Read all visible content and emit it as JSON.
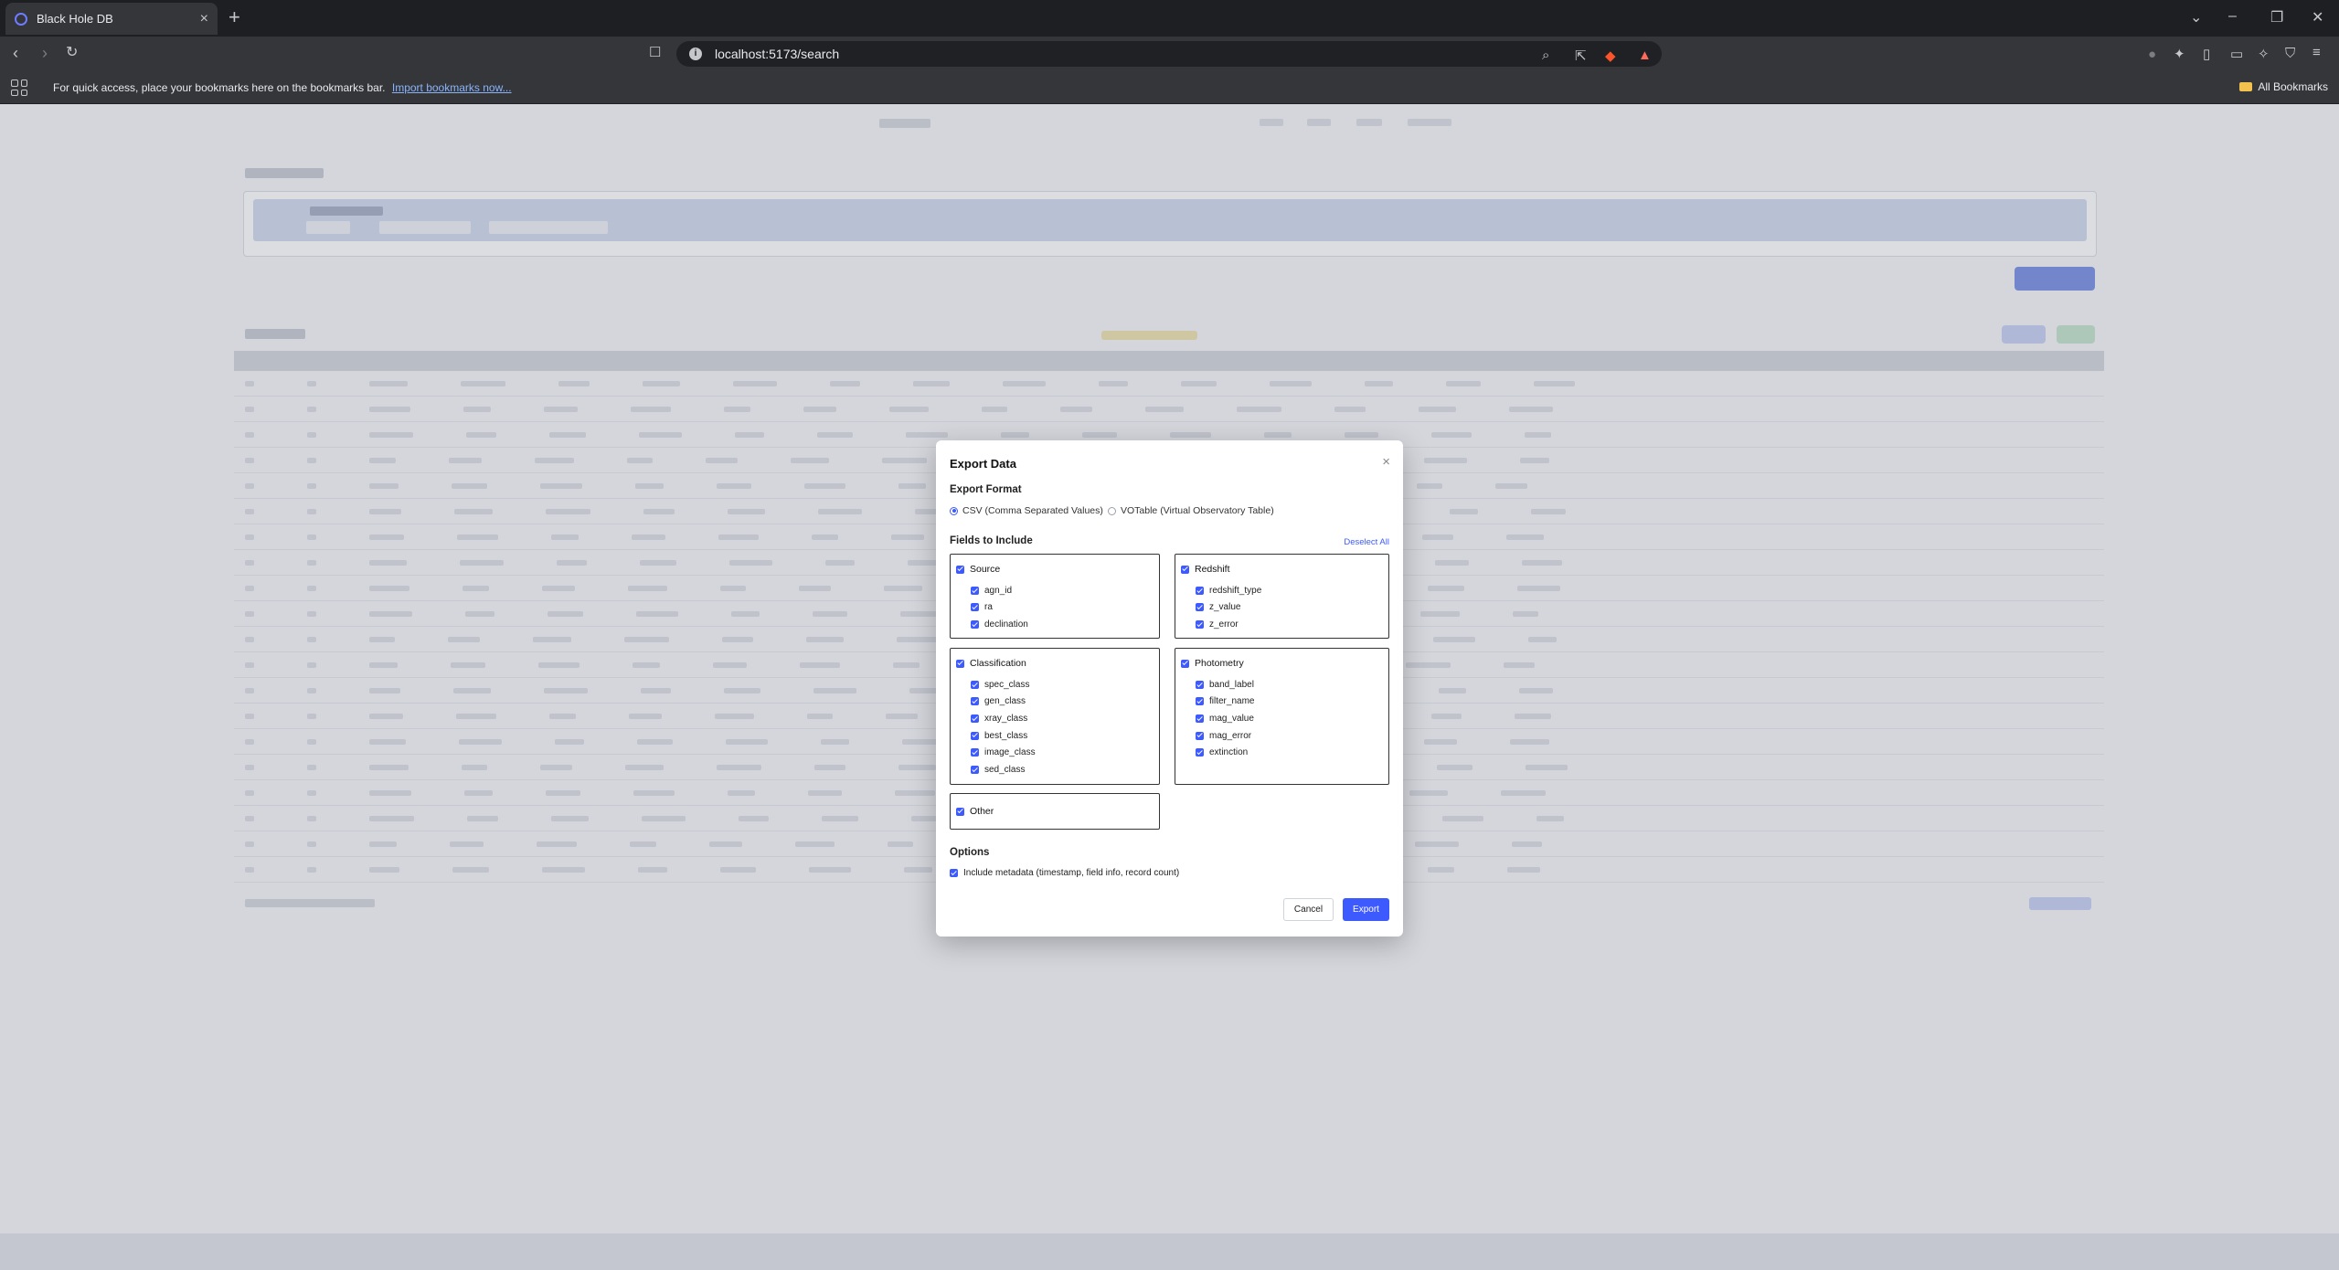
{
  "browser": {
    "tab_title": "Black Hole DB",
    "tab_close": "×",
    "new_tab": "+",
    "url": "localhost:5173/search",
    "bookmarks_bar_message": "For quick access, place your bookmarks here on the bookmarks bar.",
    "import_bookmarks_link": "Import bookmarks now...",
    "all_bookmarks": "All Bookmarks",
    "brand_colors": {
      "chrome_dark": "#35363a",
      "tabstrip": "#1e1f22",
      "link": "#8ab4f8"
    }
  },
  "modal": {
    "title": "Export Data",
    "close_symbol": "×",
    "export_format_label": "Export Format",
    "formats": [
      {
        "label": "CSV (Comma Separated Values)",
        "selected": true
      },
      {
        "label": "VOTable (Virtual Observatory Table)",
        "selected": false
      }
    ],
    "fields_label": "Fields to Include",
    "deselect_all": "Deselect All",
    "groups": {
      "source": {
        "name": "Source",
        "checked": true,
        "fields": [
          "agn_id",
          "ra",
          "declination"
        ]
      },
      "redshift": {
        "name": "Redshift",
        "checked": true,
        "fields": [
          "redshift_type",
          "z_value",
          "z_error"
        ]
      },
      "classification": {
        "name": "Classification",
        "checked": true,
        "fields": [
          "spec_class",
          "gen_class",
          "xray_class",
          "best_class",
          "image_class",
          "sed_class"
        ]
      },
      "photometry": {
        "name": "Photometry",
        "checked": true,
        "fields": [
          "band_label",
          "filter_name",
          "mag_value",
          "mag_error",
          "extinction"
        ]
      },
      "other": {
        "name": "Other",
        "checked": true,
        "fields": []
      }
    },
    "options_label": "Options",
    "include_metadata": "Include metadata (timestamp, field info, record count)",
    "cancel": "Cancel",
    "export": "Export",
    "accent_color": "#3d5afe"
  }
}
